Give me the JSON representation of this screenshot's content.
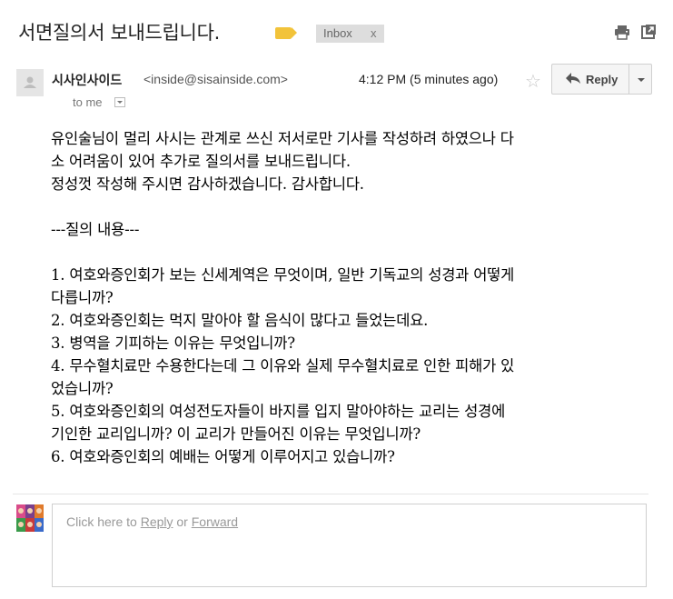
{
  "thread": {
    "subject": "서면질의서 보내드립니다.",
    "label_chip": "Inbox",
    "label_chip_close": "x",
    "icons": {
      "label": "label-tag-icon",
      "print": "print-icon",
      "open_new_window": "open-in-new-window-icon"
    }
  },
  "message": {
    "sender_name": "시사인사이드",
    "sender_email": "<inside@sisainside.com>",
    "time": "4:12 PM (5 minutes ago)",
    "star": "☆",
    "reply_label": "Reply",
    "recipient": "to me",
    "body": {
      "l1": "유인술님이 멀리 사시는 관계로 쓰신 저서로만 기사를 작성하려 하였으나 다",
      "l2": "소 어려움이 있어 추가로 질의서를 보내드립니다.",
      "l3": "정성껏 작성해 주시면 감사하겠습니다. 감사합니다.",
      "l4": "---질의 내용---",
      "l5": "1. 여호와증인회가 보는 신세계역은 무엇이며, 일반 기독교의 성경과 어떻게",
      "l6": "다릅니까?",
      "l7": "2. 여호와증인회는 먹지 말아야 할 음식이 많다고 들었는데요.",
      "l8": "3. 병역을 기피하는 이유는 무엇입니까?",
      "l9": "4. 무수혈치료만 수용한다는데 그 이유와 실제 무수혈치료로 인한 피해가 있",
      "l10": "었습니까?",
      "l11": "5. 여호와증인회의 여성전도자들이 바지를 입지 말아야하는 교리는 성경에",
      "l12": "기인한 교리입니까? 이 교리가 만들어진 이유는 무엇입니까?",
      "l13": "6. 여호와증인회의 예배는 어떻게 이루어지고 있습니까?"
    }
  },
  "compose": {
    "prefix": "Click here to ",
    "reply_link": "Reply",
    "middle": " or ",
    "forward_link": "Forward"
  },
  "colors": {
    "label_yellow": "#f2c33a",
    "chip_bg": "#dddddd",
    "link_gray": "#999999"
  }
}
